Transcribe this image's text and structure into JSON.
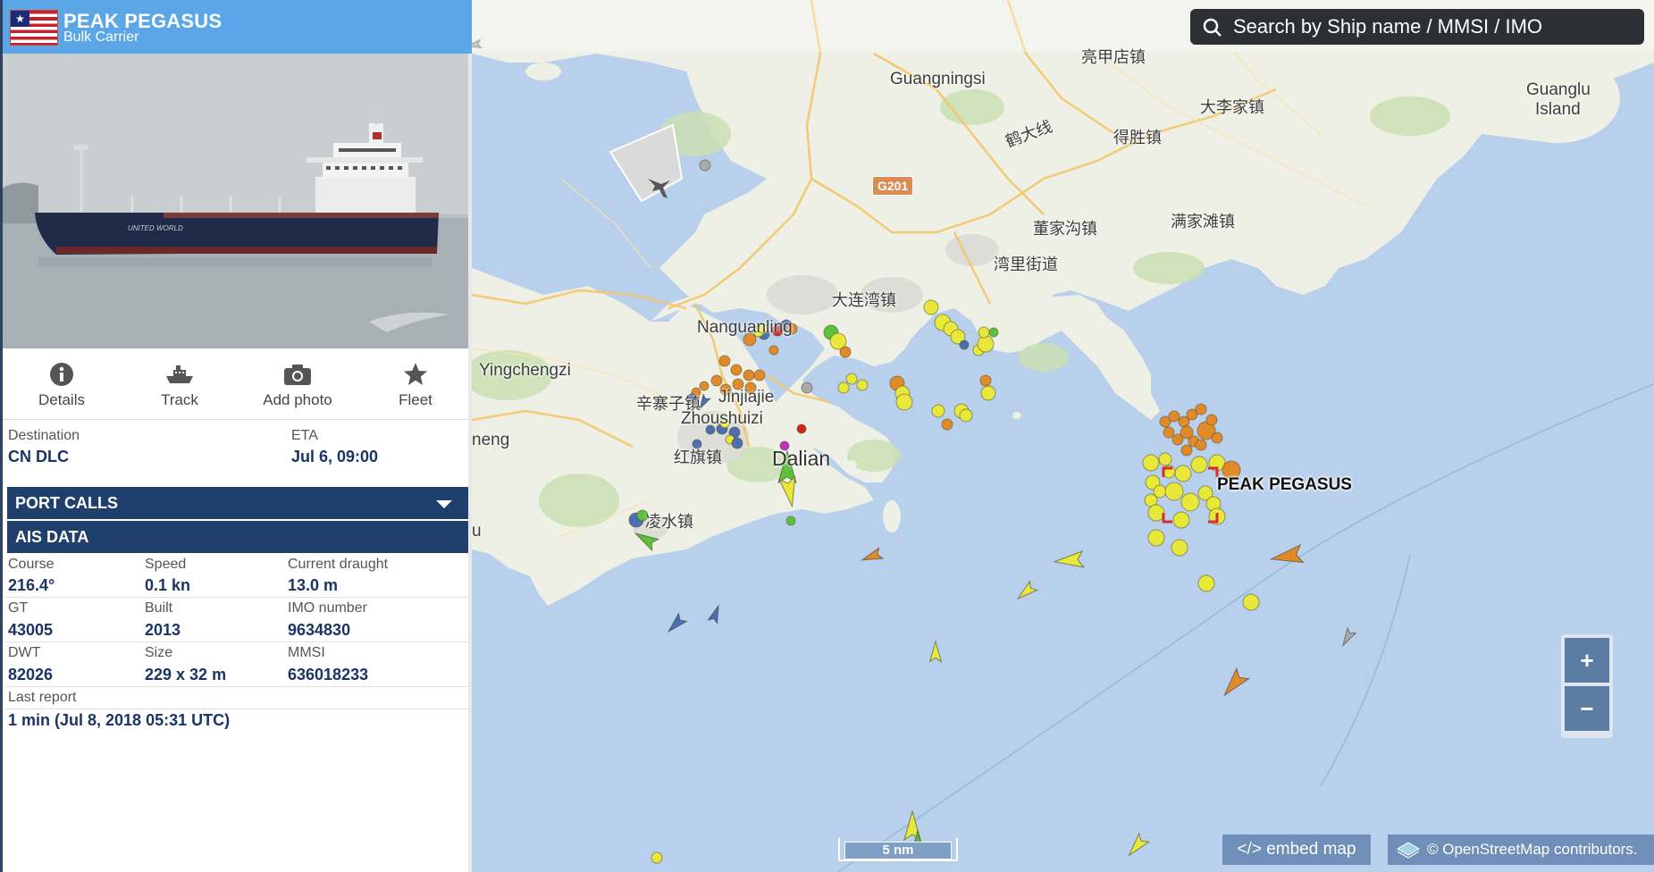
{
  "ship": {
    "name": "PEAK PEGASUS",
    "type": "Bulk Carrier",
    "flag_icon": "liberia-flag-icon"
  },
  "actions": [
    {
      "label": "Details",
      "icon": "info-icon"
    },
    {
      "label": "Track",
      "icon": "ship-track-icon"
    },
    {
      "label": "Add photo",
      "icon": "camera-icon"
    },
    {
      "label": "Fleet",
      "icon": "star-icon"
    }
  ],
  "voyage": {
    "destination_label": "Destination",
    "destination": "CN DLC",
    "eta_label": "ETA",
    "eta": "Jul 6, 09:00"
  },
  "sections": {
    "port_calls": "PORT CALLS",
    "ais_data": "AIS DATA"
  },
  "ais": {
    "course_label": "Course",
    "course": "216.4°",
    "speed_label": "Speed",
    "speed": "0.1 kn",
    "draught_label": "Current draught",
    "draught": "13.0 m",
    "gt_label": "GT",
    "gt": "43005",
    "built_label": "Built",
    "built": "2013",
    "imo_label": "IMO number",
    "imo": "9634830",
    "dwt_label": "DWT",
    "dwt": "82026",
    "size_label": "Size",
    "size": "229 x 32 m",
    "mmsi_label": "MMSI",
    "mmsi": "636018233",
    "last_report_label": "Last report",
    "last_report": "1 min (Jul 8, 2018 05:31 UTC)"
  },
  "search": {
    "placeholder": "Search by Ship name / MMSI / IMO"
  },
  "map": {
    "target_label": "PEAK PEGASUS",
    "road_shield": "G201",
    "labels": {
      "guangningsi": "Guangningsi",
      "liangzhandian": "亮甲店镇",
      "dalizijia": "大李家镇",
      "guanglu": "Guanglu",
      "guanglu2": "Island",
      "dejiang": "得胜镇",
      "xianlu": "鹤大线",
      "dongjiagou": "董家沟镇",
      "manjiatan": "满家滩镇",
      "wanli": "湾里街道",
      "dalianwan": "大连湾镇",
      "nanguanling": "Nanguanling",
      "yingchengzi": "Yingchengzi",
      "xinzhaizi": "辛寨子镇",
      "jinjiajie": "Jinjiajie",
      "zhoushuizi": "Zhoushuizi",
      "hongqi": "红旗镇",
      "dalian": "Dalian",
      "lingshui": "凌水镇",
      "heng": "neng",
      "edge_u": "u"
    },
    "scale_text": "5 nm",
    "zoom_in": "+",
    "zoom_out": "−",
    "embed": "</> embed map",
    "attribution": "© OpenStreetMap contributors."
  },
  "colors": {
    "header_blue": "#5aa6e6",
    "section_navy": "#1f3f6c",
    "value_navy": "#1a3466",
    "sea": "#b8d0ec",
    "land": "#eef0e6",
    "vessel_yellow": "#e8e83a",
    "vessel_orange": "#e08a2a",
    "vessel_green": "#5cc13a",
    "vessel_blue": "#4b6fb0",
    "target_box": "#d23030"
  }
}
